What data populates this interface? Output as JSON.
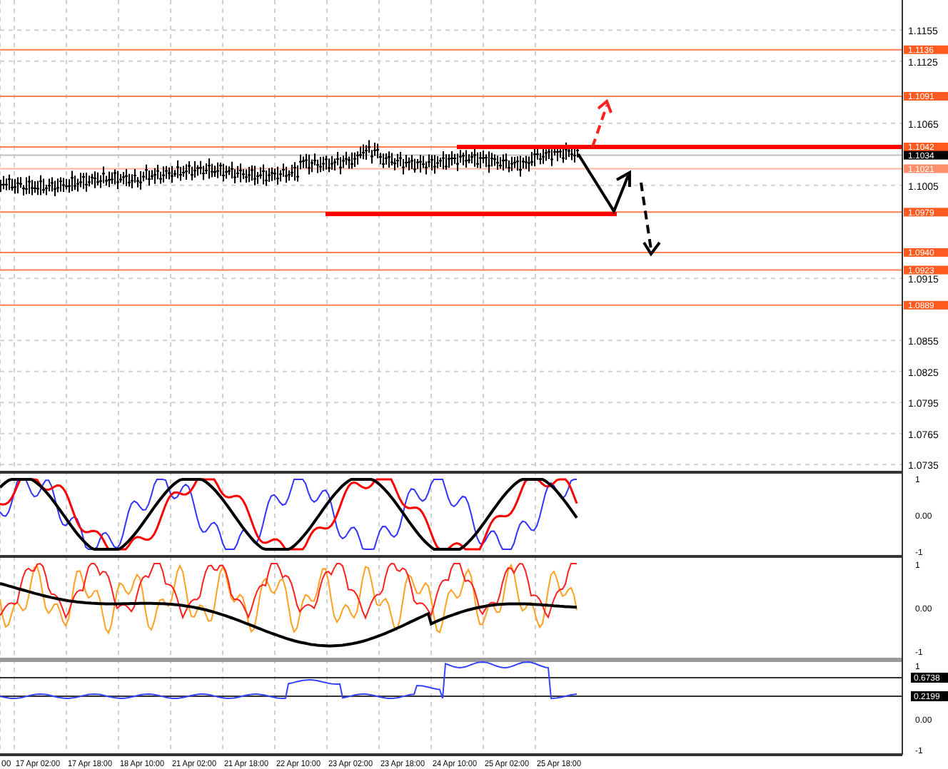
{
  "main_pane": {
    "price_axis_ticks": [
      "1.1155",
      "1.1125",
      "1.1065",
      "1.1005",
      "1.0915",
      "1.0855",
      "1.0825",
      "1.0795",
      "1.0765",
      "1.0735"
    ],
    "levels": [
      {
        "label": "1.1136",
        "kind": "level"
      },
      {
        "label": "1.1091",
        "kind": "level"
      },
      {
        "label": "1.1042",
        "kind": "level"
      },
      {
        "label": "1.1034",
        "kind": "current"
      },
      {
        "label": "1.1021",
        "kind": "faint"
      },
      {
        "label": "1.0979",
        "kind": "level"
      },
      {
        "label": "1.0940",
        "kind": "level"
      },
      {
        "label": "1.0923",
        "kind": "level"
      },
      {
        "label": "1.0889",
        "kind": "level"
      }
    ]
  },
  "indicator_panes": [
    {
      "axis_labels": [
        "1",
        "0.00",
        "-1"
      ]
    },
    {
      "axis_labels": [
        "1",
        "0.00",
        "-1"
      ]
    },
    {
      "axis_labels": [
        "1",
        "0.00",
        "-1"
      ],
      "value_tags": [
        "0.6738",
        "0.2199"
      ]
    }
  ],
  "time_axis": [
    "00",
    "17 Apr 02:00",
    "17 Apr 18:00",
    "18 Apr 10:00",
    "21 Apr 02:00",
    "21 Apr 18:00",
    "22 Apr 10:00",
    "23 Apr 02:00",
    "23 Apr 18:00",
    "24 Apr 10:00",
    "25 Apr 02:00",
    "25 Apr 18:00"
  ]
}
